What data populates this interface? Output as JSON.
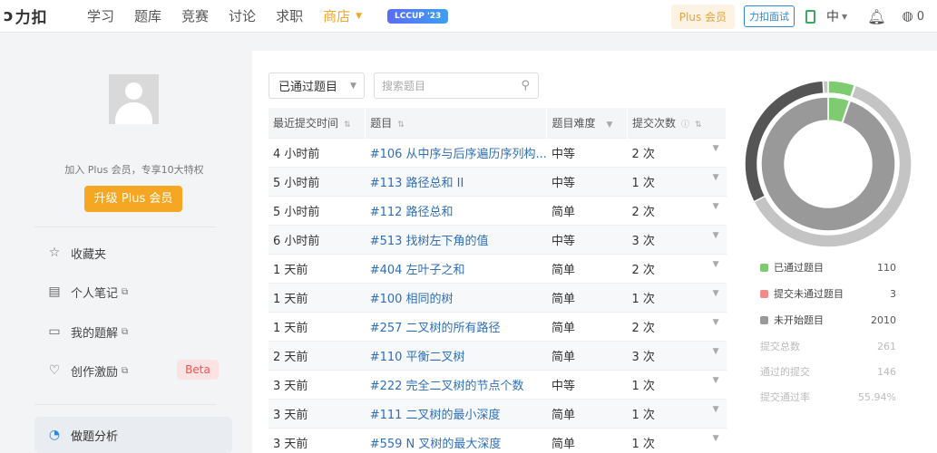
{
  "nav": {
    "logo_text": "力扣",
    "items": [
      "学习",
      "题库",
      "竞赛",
      "讨论",
      "求职"
    ],
    "store": "商店",
    "lccup": "LCCUP '23",
    "plus": "Plus 会员",
    "interview": "力扣面试",
    "lang": "中",
    "coins": "0"
  },
  "sidebar": {
    "plus_hint": "加入 Plus 会员，专享10大特权",
    "upgrade": "升级 Plus 会员",
    "items": [
      {
        "label": "收藏夹"
      },
      {
        "label": "个人笔记"
      },
      {
        "label": "我的题解"
      },
      {
        "label": "创作激励"
      }
    ],
    "beta": "Beta",
    "active": "做题分析"
  },
  "toolbar": {
    "filter": "已通过题目",
    "search_placeholder": "搜索题目"
  },
  "table": {
    "headers": [
      "最近提交时间",
      "题目",
      "题目难度",
      "提交次数"
    ],
    "rows": [
      {
        "time": "4 小时前",
        "title": "#106 从中序与后序遍历序列构...",
        "difficulty": "中等",
        "submits": "2 次"
      },
      {
        "time": "5 小时前",
        "title": "#113 路径总和 II",
        "difficulty": "中等",
        "submits": "1 次"
      },
      {
        "time": "5 小时前",
        "title": "#112 路径总和",
        "difficulty": "简单",
        "submits": "2 次"
      },
      {
        "time": "6 小时前",
        "title": "#513 找树左下角的值",
        "difficulty": "中等",
        "submits": "3 次"
      },
      {
        "time": "1 天前",
        "title": "#404 左叶子之和",
        "difficulty": "简单",
        "submits": "2 次"
      },
      {
        "time": "1 天前",
        "title": "#100 相同的树",
        "difficulty": "简单",
        "submits": "1 次"
      },
      {
        "time": "1 天前",
        "title": "#257 二叉树的所有路径",
        "difficulty": "简单",
        "submits": "2 次"
      },
      {
        "time": "2 天前",
        "title": "#110 平衡二叉树",
        "difficulty": "简单",
        "submits": "3 次"
      },
      {
        "time": "3 天前",
        "title": "#222 完全二叉树的节点个数",
        "difficulty": "中等",
        "submits": "1 次"
      },
      {
        "time": "3 天前",
        "title": "#111 二叉树的最小深度",
        "difficulty": "简单",
        "submits": "1 次"
      },
      {
        "time": "3 天前",
        "title": "#559 N 叉树的最大深度",
        "difficulty": "简单",
        "submits": "1 次"
      }
    ]
  },
  "stats": {
    "legend": [
      {
        "label": "已通过题目",
        "value": "110",
        "color": "#7ecb72"
      },
      {
        "label": "提交未通过题目",
        "value": "3",
        "color": "#f08c8c"
      },
      {
        "label": "未开始题目",
        "value": "2010",
        "color": "#999999"
      }
    ],
    "extra": [
      {
        "label": "提交总数",
        "value": "261"
      },
      {
        "label": "通过的提交",
        "value": "146"
      },
      {
        "label": "提交通过率",
        "value": "55.94%"
      }
    ]
  },
  "chart_data": {
    "type": "pie",
    "categories": [
      "已通过题目",
      "提交未通过题目",
      "未开始题目"
    ],
    "values": [
      110,
      3,
      2010
    ],
    "colors": [
      "#7ecb72",
      "#f08c8c",
      "#999999"
    ]
  }
}
